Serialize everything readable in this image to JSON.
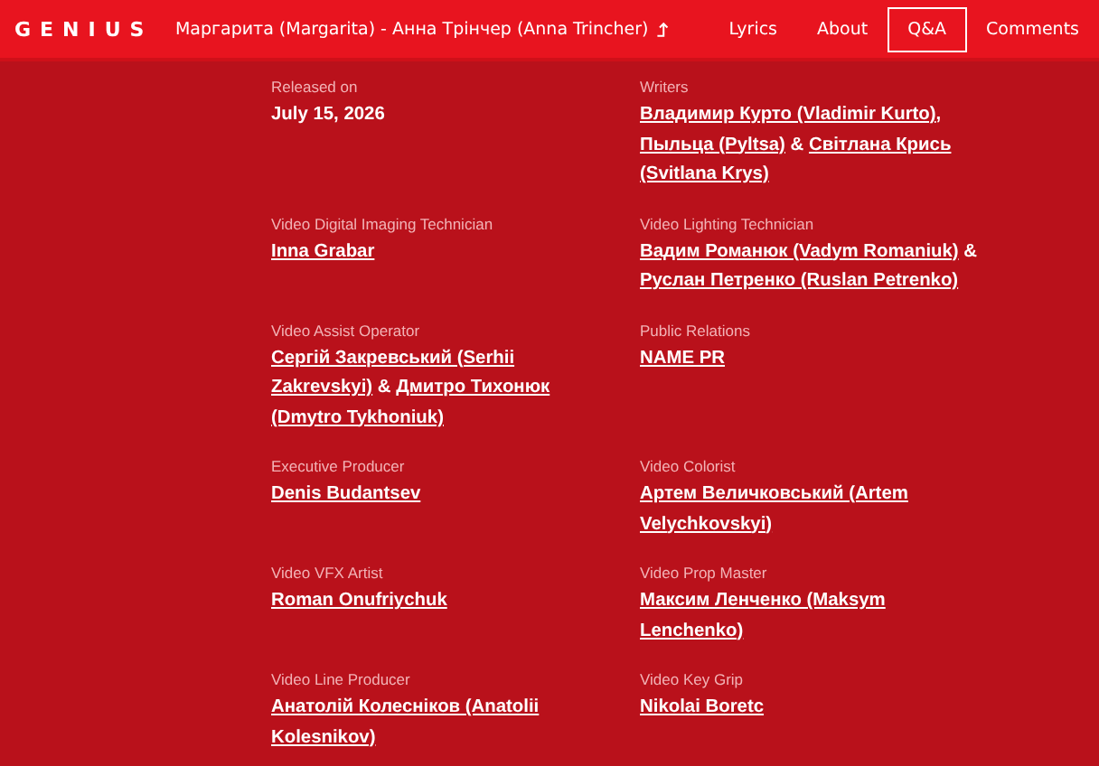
{
  "header": {
    "logo": "GENIUS",
    "song_title": "Маргарита (Margarita) - Анна Трінчер (Anna Trincher)",
    "nav": [
      {
        "label": "Lyrics",
        "selected": false
      },
      {
        "label": "About",
        "selected": false
      },
      {
        "label": "Q&A",
        "selected": true
      },
      {
        "label": "Comments",
        "selected": false
      }
    ]
  },
  "credits": [
    {
      "label": "Released on",
      "parts": [
        {
          "text": "July 15, 2026",
          "link": false
        }
      ]
    },
    {
      "label": "Writers",
      "parts": [
        {
          "text": "Владимир Курто (Vladimir Kurto)",
          "link": true
        },
        {
          "text": ", ",
          "link": false
        },
        {
          "text": "Пыльца (Pyltsa)",
          "link": true
        },
        {
          "text": " & ",
          "link": false
        },
        {
          "text": "Світлана Крись",
          "link": true
        },
        {
          "text": "(Svitlana Krys)",
          "link": true
        }
      ]
    },
    {
      "label": "Video Digital Imaging Technician",
      "parts": [
        {
          "text": "Inna Grabar",
          "link": true
        }
      ]
    },
    {
      "label": "Video Lighting Technician",
      "parts": [
        {
          "text": "Вадим Романюк (Vadym Romaniuk)",
          "link": true
        },
        {
          "text": " & ",
          "link": false
        },
        {
          "text": "Руслан Петренко (Ruslan Petrenko)",
          "link": true
        }
      ]
    },
    {
      "label": "Video Assist Operator",
      "parts": [
        {
          "text": "Сергій Закревський (Serhii",
          "link": true
        },
        {
          "text": "Zakrevskyi)",
          "link": true
        },
        {
          "text": " & ",
          "link": false
        },
        {
          "text": "Дмитро Тихонюк",
          "link": true
        },
        {
          "text": "(Dmytro Tykhoniuk)",
          "link": true
        }
      ]
    },
    {
      "label": "Public Relations",
      "parts": [
        {
          "text": "NAME PR",
          "link": true
        }
      ]
    },
    {
      "label": "Executive Producer",
      "parts": [
        {
          "text": "Denis Budantsev",
          "link": true
        }
      ]
    },
    {
      "label": "Video Colorist",
      "parts": [
        {
          "text": "Артем Величковський (Artem",
          "link": true
        },
        {
          "text": "Velychkovskyi)",
          "link": true
        }
      ]
    },
    {
      "label": "Video VFX Artist",
      "parts": [
        {
          "text": "Roman Onufriychuk",
          "link": true
        }
      ]
    },
    {
      "label": "Video Prop Master",
      "parts": [
        {
          "text": "Максим Ленченко (Maksym",
          "link": true
        },
        {
          "text": "Lenchenko)",
          "link": true
        }
      ]
    },
    {
      "label": "Video Line Producer",
      "parts": [
        {
          "text": "Анатолій Колесніков (Anatolii",
          "link": true
        },
        {
          "text": "Kolesnikov)",
          "link": true
        }
      ]
    },
    {
      "label": "Video Key Grip",
      "parts": [
        {
          "text": "Nikolai Boretc",
          "link": true
        }
      ]
    }
  ]
}
